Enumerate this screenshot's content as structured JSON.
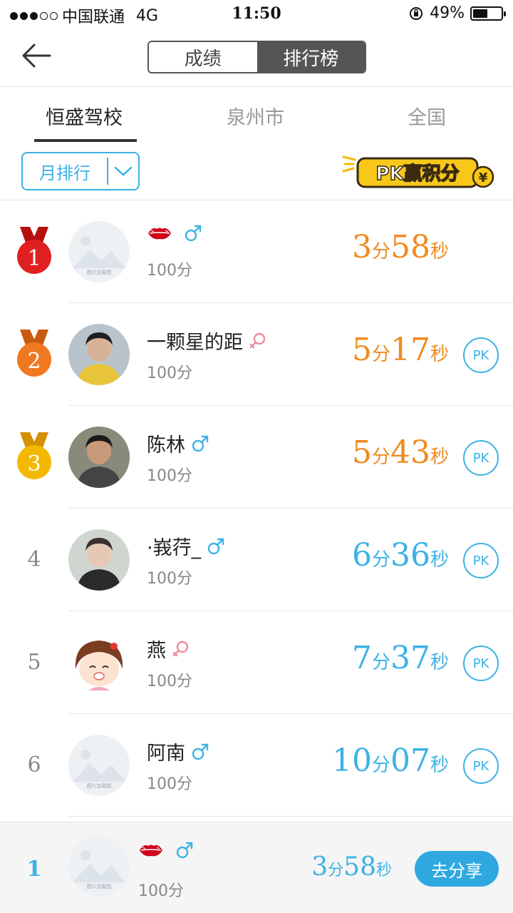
{
  "status_bar": {
    "carrier": "中国联通",
    "network": "4G",
    "time": "11:50",
    "battery": "49%",
    "battery_level": 0.49,
    "signal_bars": 3,
    "signal_total": 5
  },
  "nav": {
    "segments": [
      "成绩",
      "排行榜"
    ],
    "active_segment": 1
  },
  "tabs": [
    "恒盛驾校",
    "泉州市",
    "全国"
  ],
  "active_tab": 0,
  "filter": {
    "label": "月排行"
  },
  "pk_banner": {
    "text": "PK赢积分"
  },
  "ranking": [
    {
      "rank": "1",
      "name": "",
      "name_icon": "lips",
      "gender": "male",
      "points": "100分",
      "min": "3",
      "sec": "58",
      "min_unit": "分",
      "sec_unit": "秒",
      "color": "#f08a1e",
      "medal": "red",
      "avatar": "placeholder",
      "pk": false
    },
    {
      "rank": "2",
      "name": "一颗星的距",
      "gender": "female",
      "points": "100分",
      "min": "5",
      "sec": "17",
      "min_unit": "分",
      "sec_unit": "秒",
      "color": "#f08a1e",
      "medal": "orange",
      "avatar": "photo",
      "pk": true,
      "pk_label": "PK"
    },
    {
      "rank": "3",
      "name": "陈林",
      "gender": "male",
      "points": "100分",
      "min": "5",
      "sec": "43",
      "min_unit": "分",
      "sec_unit": "秒",
      "color": "#f08a1e",
      "medal": "gold",
      "avatar": "photo",
      "pk": true,
      "pk_label": "PK"
    },
    {
      "rank": "4",
      "name": "·峩荇_",
      "gender": "male",
      "points": "100分",
      "min": "6",
      "sec": "36",
      "min_unit": "分",
      "sec_unit": "秒",
      "color": "#3bb2e6",
      "medal": "",
      "avatar": "photo",
      "pk": true,
      "pk_label": "PK"
    },
    {
      "rank": "5",
      "name": "燕",
      "gender": "female",
      "points": "100分",
      "min": "7",
      "sec": "37",
      "min_unit": "分",
      "sec_unit": "秒",
      "color": "#3bb2e6",
      "medal": "",
      "avatar": "cartoon",
      "pk": true,
      "pk_label": "PK"
    },
    {
      "rank": "6",
      "name": "阿南",
      "gender": "male",
      "points": "100分",
      "min": "10",
      "sec": "07",
      "min_unit": "分",
      "sec_unit": "秒",
      "color": "#3bb2e6",
      "medal": "",
      "avatar": "placeholder",
      "pk": true,
      "pk_label": "PK"
    }
  ],
  "my_rank": {
    "rank": "1",
    "name": "",
    "name_icon": "lips",
    "gender": "male",
    "points": "100分",
    "min": "3",
    "sec": "58",
    "min_unit": "分",
    "sec_unit": "秒",
    "color": "#3bb2e6",
    "share_label": "去分享"
  },
  "colors": {
    "accent": "#3bb2e6",
    "top_time": "#f08a1e",
    "male": "#3bb2e6",
    "female": "#f08a9a"
  }
}
